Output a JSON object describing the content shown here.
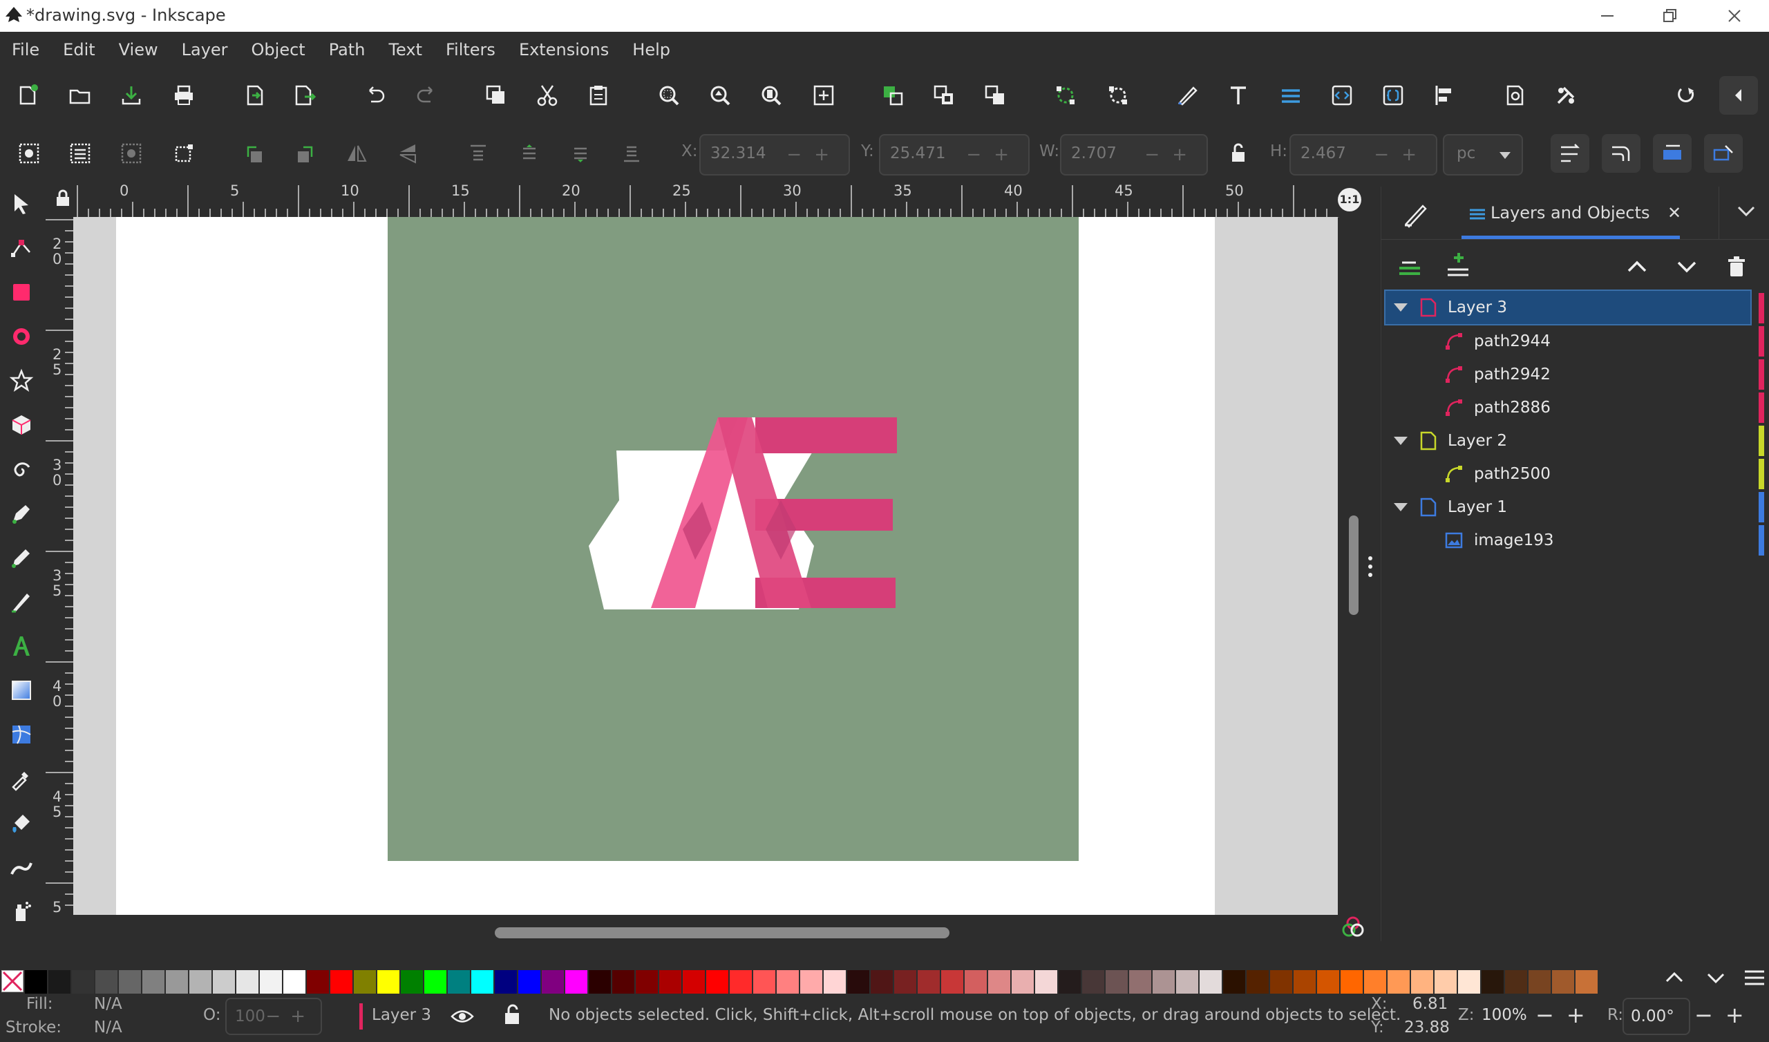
{
  "window": {
    "title": "*drawing.svg - Inkscape",
    "controls": [
      "minimize-icon",
      "restore-icon",
      "close-icon"
    ]
  },
  "menu": [
    "File",
    "Edit",
    "View",
    "Layer",
    "Object",
    "Path",
    "Text",
    "Filters",
    "Extensions",
    "Help"
  ],
  "toolbar_controls": {
    "x_label": "X:",
    "x_value": "32.314",
    "y_label": "Y:",
    "y_value": "25.471",
    "w_label": "W:",
    "w_value": "2.707",
    "h_label": "H:",
    "h_value": "2.467",
    "unit": "pc"
  },
  "ruler": {
    "horizontal": [
      "0",
      "5",
      "10",
      "15",
      "20",
      "25",
      "30",
      "35",
      "40",
      "45",
      "50"
    ],
    "vertical": [
      "2 0",
      "2 5",
      "3 0",
      "3 5",
      "4 0",
      "4 5",
      "5"
    ]
  },
  "dock": {
    "tab_label": "Layers and Objects",
    "layers": [
      {
        "name": "Layer 3",
        "kind": "layer",
        "color": "#e0245e",
        "selected": true
      },
      {
        "name": "path2944",
        "kind": "path",
        "color": "#e0245e"
      },
      {
        "name": "path2942",
        "kind": "path",
        "color": "#e0245e"
      },
      {
        "name": "path2886",
        "kind": "path",
        "color": "#e0245e"
      },
      {
        "name": "Layer 2",
        "kind": "layer",
        "color": "#c8d82a"
      },
      {
        "name": "path2500",
        "kind": "path",
        "color": "#c8d82a"
      },
      {
        "name": "Layer 1",
        "kind": "layer",
        "color": "#3d7be0"
      },
      {
        "name": "image193",
        "kind": "image",
        "color": "#3d7be0"
      }
    ]
  },
  "status": {
    "fill_label": "Fill:",
    "fill_value": "N/A",
    "stroke_label": "Stroke:",
    "stroke_value": "N/A",
    "opacity_label": "O:",
    "opacity_value": "100",
    "layer": "Layer 3",
    "message": "No objects selected. Click, Shift+click, Alt+scroll mouse on top of objects, or drag around objects to select.",
    "cursor_x_label": "X:",
    "cursor_x": "6.81",
    "cursor_y_label": "Y:",
    "cursor_y": "23.88",
    "zoom_label": "Z:",
    "zoom": "100%",
    "rotate_label": "R:",
    "rotate": "0.00°"
  },
  "colors": {
    "accent_blue": "#1e4b7c",
    "canvas_bg": "#819c80",
    "logo_pink": "#f0568f",
    "logo_dark_pink": "#d63e78"
  },
  "palette": [
    "#000000",
    "#1a1a1a",
    "#333333",
    "#4d4d4d",
    "#666666",
    "#808080",
    "#999999",
    "#b3b3b3",
    "#cccccc",
    "#e6e6e6",
    "#f2f2f2",
    "#ffffff",
    "#800000",
    "#ff0000",
    "#808000",
    "#ffff00",
    "#008000",
    "#00ff00",
    "#008080",
    "#00ffff",
    "#000080",
    "#0000ff",
    "#800080",
    "#ff00ff",
    "#2b0000",
    "#550000",
    "#800000",
    "#aa0000",
    "#d40000",
    "#ff0000",
    "#ff2a2a",
    "#ff5555",
    "#ff8080",
    "#ffaaaa",
    "#ffd5d5",
    "#280b0b",
    "#501616",
    "#782121",
    "#a02c2c",
    "#c83737",
    "#d35f5f",
    "#de8787",
    "#e9afaf",
    "#f4d7d7",
    "#241c1c",
    "#483737",
    "#6c5353",
    "#916f6f",
    "#ac9393",
    "#c8b7b7",
    "#e3dbdb",
    "#2b1100",
    "#552200",
    "#803300",
    "#aa4400",
    "#d45500",
    "#ff6600",
    "#ff7f2a",
    "#ff9955",
    "#ffb380",
    "#ffccaa",
    "#ffe6d5",
    "#28170b",
    "#502d16",
    "#784421",
    "#a05a2c",
    "#c87137"
  ]
}
